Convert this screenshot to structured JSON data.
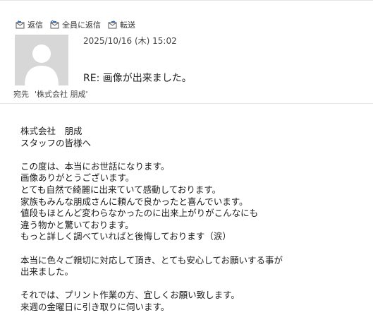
{
  "toolbar": {
    "reply_label": "返信",
    "reply_all_label": "全員に返信",
    "forward_label": "転送"
  },
  "message": {
    "date": "2025/10/16 (木) 15:02",
    "subject": "RE: 画像が出来ました。",
    "to_label": "宛先",
    "to_value": "'株式会社 朋成'"
  },
  "body": {
    "lines": [
      "株式会社　朋成",
      "スタッフの皆様へ",
      "",
      "この度は、本当にお世話になります。",
      "画像ありがとうございます。",
      "とても自然で綺麗に出来ていて感動しております。",
      "家族もみんな朋成さんに頼んで良かったと喜んでいます。",
      "値段もほとんど変わらなかったのに出来上がりがこんなにも",
      "違う物かと驚いております。",
      "もっと詳しく調べていればと後悔しております（涙）",
      "",
      "本当に色々ご親切に対応して頂き、とても安心してお願いする事が",
      "出来ました。",
      "",
      "それでは、プリント作業の方、宜しくお願い致します。",
      "来週の金曜日に引き取りに伺います。"
    ]
  },
  "icons": {
    "reply": "reply-icon",
    "reply_all": "reply-all-icon",
    "forward": "forward-icon",
    "avatar": "avatar-placeholder"
  },
  "colors": {
    "icon_blue": "#3b6fb6",
    "avatar_bg": "#d7d7d7"
  }
}
